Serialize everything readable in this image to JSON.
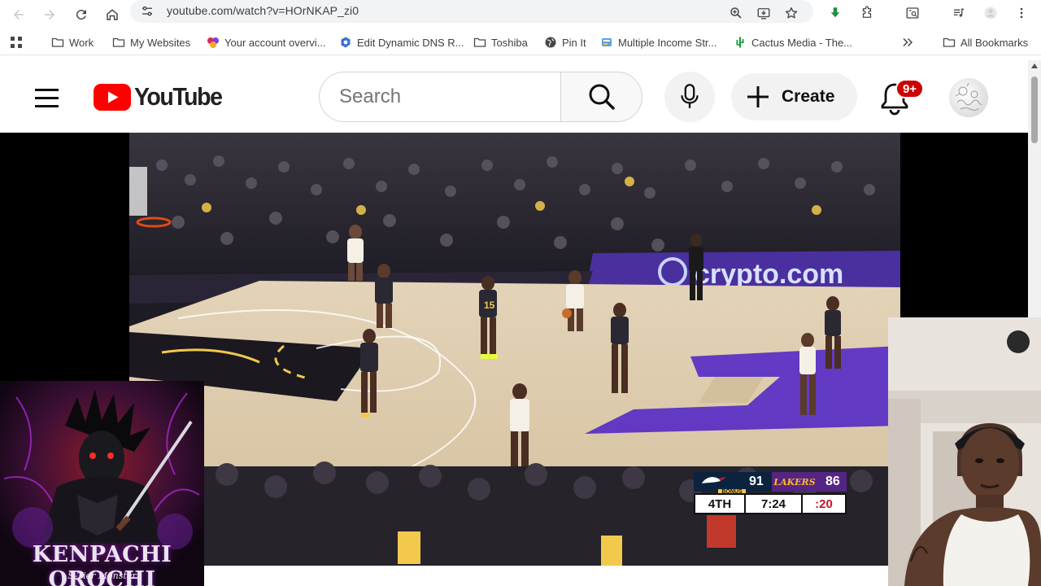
{
  "browser": {
    "url": "youtube.com/watch?v=HOrNKAP_zi0",
    "nav_icons": [
      "back-icon",
      "forward-icon",
      "reload-icon",
      "home-icon",
      "site-info-icon"
    ],
    "toolbar_icons": [
      "zoom-icon",
      "install-icon",
      "bookmark-star-icon",
      "download-icon",
      "extensions-icon",
      "reading-mode-icon",
      "media-control-icon",
      "profile-icon",
      "more-icon"
    ]
  },
  "bookmarks": {
    "items": [
      {
        "label": "Work",
        "icon": "folder-icon"
      },
      {
        "label": "My Websites",
        "icon": "folder-icon"
      },
      {
        "label": "Your account overvi...",
        "icon": "account-favicon"
      },
      {
        "label": "Edit Dynamic DNS R...",
        "icon": "dns-favicon"
      },
      {
        "label": "Toshiba",
        "icon": "folder-icon"
      },
      {
        "label": "Pin It",
        "icon": "globe-icon"
      },
      {
        "label": "Multiple Income Str...",
        "icon": "income-favicon"
      },
      {
        "label": "Cactus Media - The...",
        "icon": "cactus-favicon"
      }
    ],
    "all_label": "All Bookmarks"
  },
  "youtube": {
    "logo_text": "YouTube",
    "search_placeholder": "Search",
    "create_label": "Create",
    "notification_count": "9+"
  },
  "video": {
    "scorebug": {
      "home_score": "91",
      "away_team_text": "LAKERS",
      "away_score": "86",
      "bonus_label": "BONUS",
      "quarter": "4TH",
      "game_clock": "7:24",
      "shot_clock": ":20"
    },
    "arena_sign": "crypto.com"
  },
  "overlay": {
    "art_title": "KENPACHI OROCHI",
    "art_subtitle": "S-Tier Monster"
  },
  "colors": {
    "youtube_red": "#ff0000",
    "badge_red": "#cc0000",
    "lakers_purple": "#552583",
    "lakers_gold": "#fdb927",
    "pelicans_navy": "#0c2340"
  }
}
